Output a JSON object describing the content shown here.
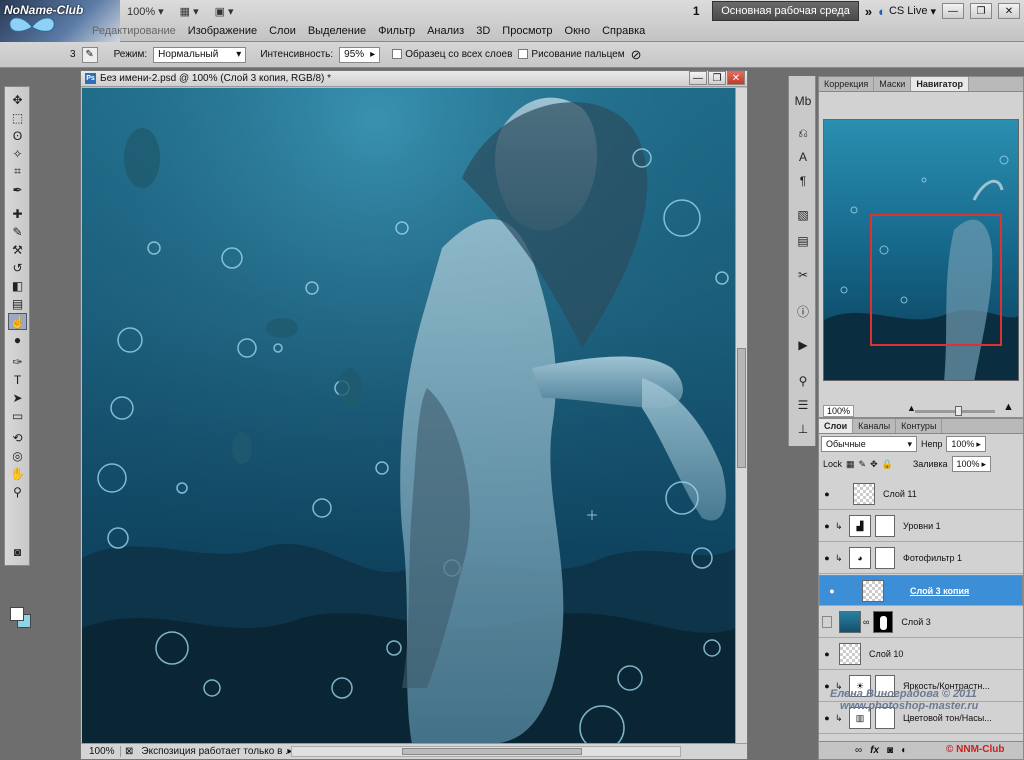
{
  "logo": {
    "text": "NoName-Club"
  },
  "topbar": {
    "zoom": "100%",
    "workspace_count": "1",
    "workspace_button": "Основная рабочая среда",
    "cslive": "CS Live"
  },
  "menu": {
    "items": [
      "Редактирование",
      "Изображение",
      "Слои",
      "Выделение",
      "Фильтр",
      "Анализ",
      "3D",
      "Просмотр",
      "Окно",
      "Справка"
    ]
  },
  "options": {
    "brush_size": "3",
    "mode_label": "Режим:",
    "mode_value": "Нормальный",
    "intensity_label": "Интенсивность:",
    "intensity_value": "95%",
    "sample_all_label": "Образец со всех слоев",
    "finger_label": "Рисование пальцем"
  },
  "document": {
    "title": "Без имени-2.psd @ 100% (Слой 3 копия, RGB/8) *",
    "icon": "Ps",
    "zoom": "100%",
    "status": "Экспозиция работает только в ..."
  },
  "navigator": {
    "tabs": [
      "Коррекция",
      "Маски",
      "Навигатор"
    ],
    "zoom": "100%"
  },
  "layers": {
    "tabs": [
      "Слои",
      "Каналы",
      "Контуры"
    ],
    "blend_mode": "Обычные",
    "opacity_label": "Непр",
    "opacity_value": "100%",
    "lock_label": "Lock",
    "fill_label": "Заливка",
    "fill_value": "100%",
    "items": [
      {
        "name": "Слой 11",
        "type": "pixel",
        "eye": "●"
      },
      {
        "name": "Уровни 1",
        "type": "adjust",
        "eye": "●"
      },
      {
        "name": "Фотофильтр 1",
        "type": "adjust",
        "eye": "●"
      },
      {
        "name": "Слой 3 копия",
        "type": "pixel",
        "eye": "●"
      },
      {
        "name": "Слой 3",
        "type": "masked",
        "eye": ""
      },
      {
        "name": "Слой 10",
        "type": "pixel",
        "eye": "●"
      },
      {
        "name": "Яркость/Контрастн...",
        "type": "adjust",
        "eye": "●"
      },
      {
        "name": "Цветовой тон/Насы...",
        "type": "adjust",
        "eye": "●"
      }
    ]
  },
  "watermark": {
    "line1": "Елена Виноградова © 2011",
    "line2": "www.photoshop-master.ru",
    "nnm": "© NNM-Club"
  }
}
